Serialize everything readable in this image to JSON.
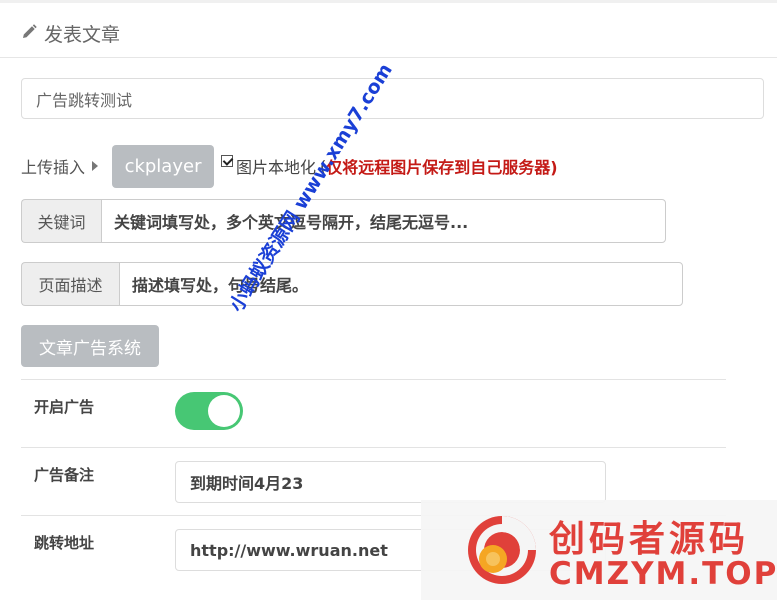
{
  "header": {
    "title": "发表文章",
    "icon": "pencil-icon"
  },
  "article": {
    "title_value": "广告跳转测试"
  },
  "upload": {
    "label": "上传插入",
    "player_button": "ckplayer",
    "localize_checked": true,
    "localize_label": "图片本地化",
    "localize_paren": "(",
    "localize_note": "仅将远程图片保存到自己服务器)"
  },
  "keywords": {
    "addon": "关键词",
    "placeholder": "关键词填写处，多个英文逗号隔开，结尾无逗号..."
  },
  "description": {
    "addon": "页面描述",
    "placeholder": "描述填写处，句号结尾。"
  },
  "ad_system": {
    "button_label": "文章广告系统",
    "rows": [
      {
        "label": "开启广告",
        "enabled": true
      },
      {
        "label": "广告备注",
        "value": "到期时间4月23"
      },
      {
        "label": "跳转地址",
        "value": "http://www.wruan.net"
      }
    ]
  },
  "watermark": {
    "text": "小蚂蚁资源网 www.xmy7.com"
  },
  "brand": {
    "name_cn": "创码者源码",
    "name_en": "CMZYM.TOP"
  },
  "colors": {
    "toggle_on": "#47c774",
    "note_red": "#c41a16",
    "watermark_blue": "#1a3fd6",
    "brand_red": "#e0403a"
  }
}
